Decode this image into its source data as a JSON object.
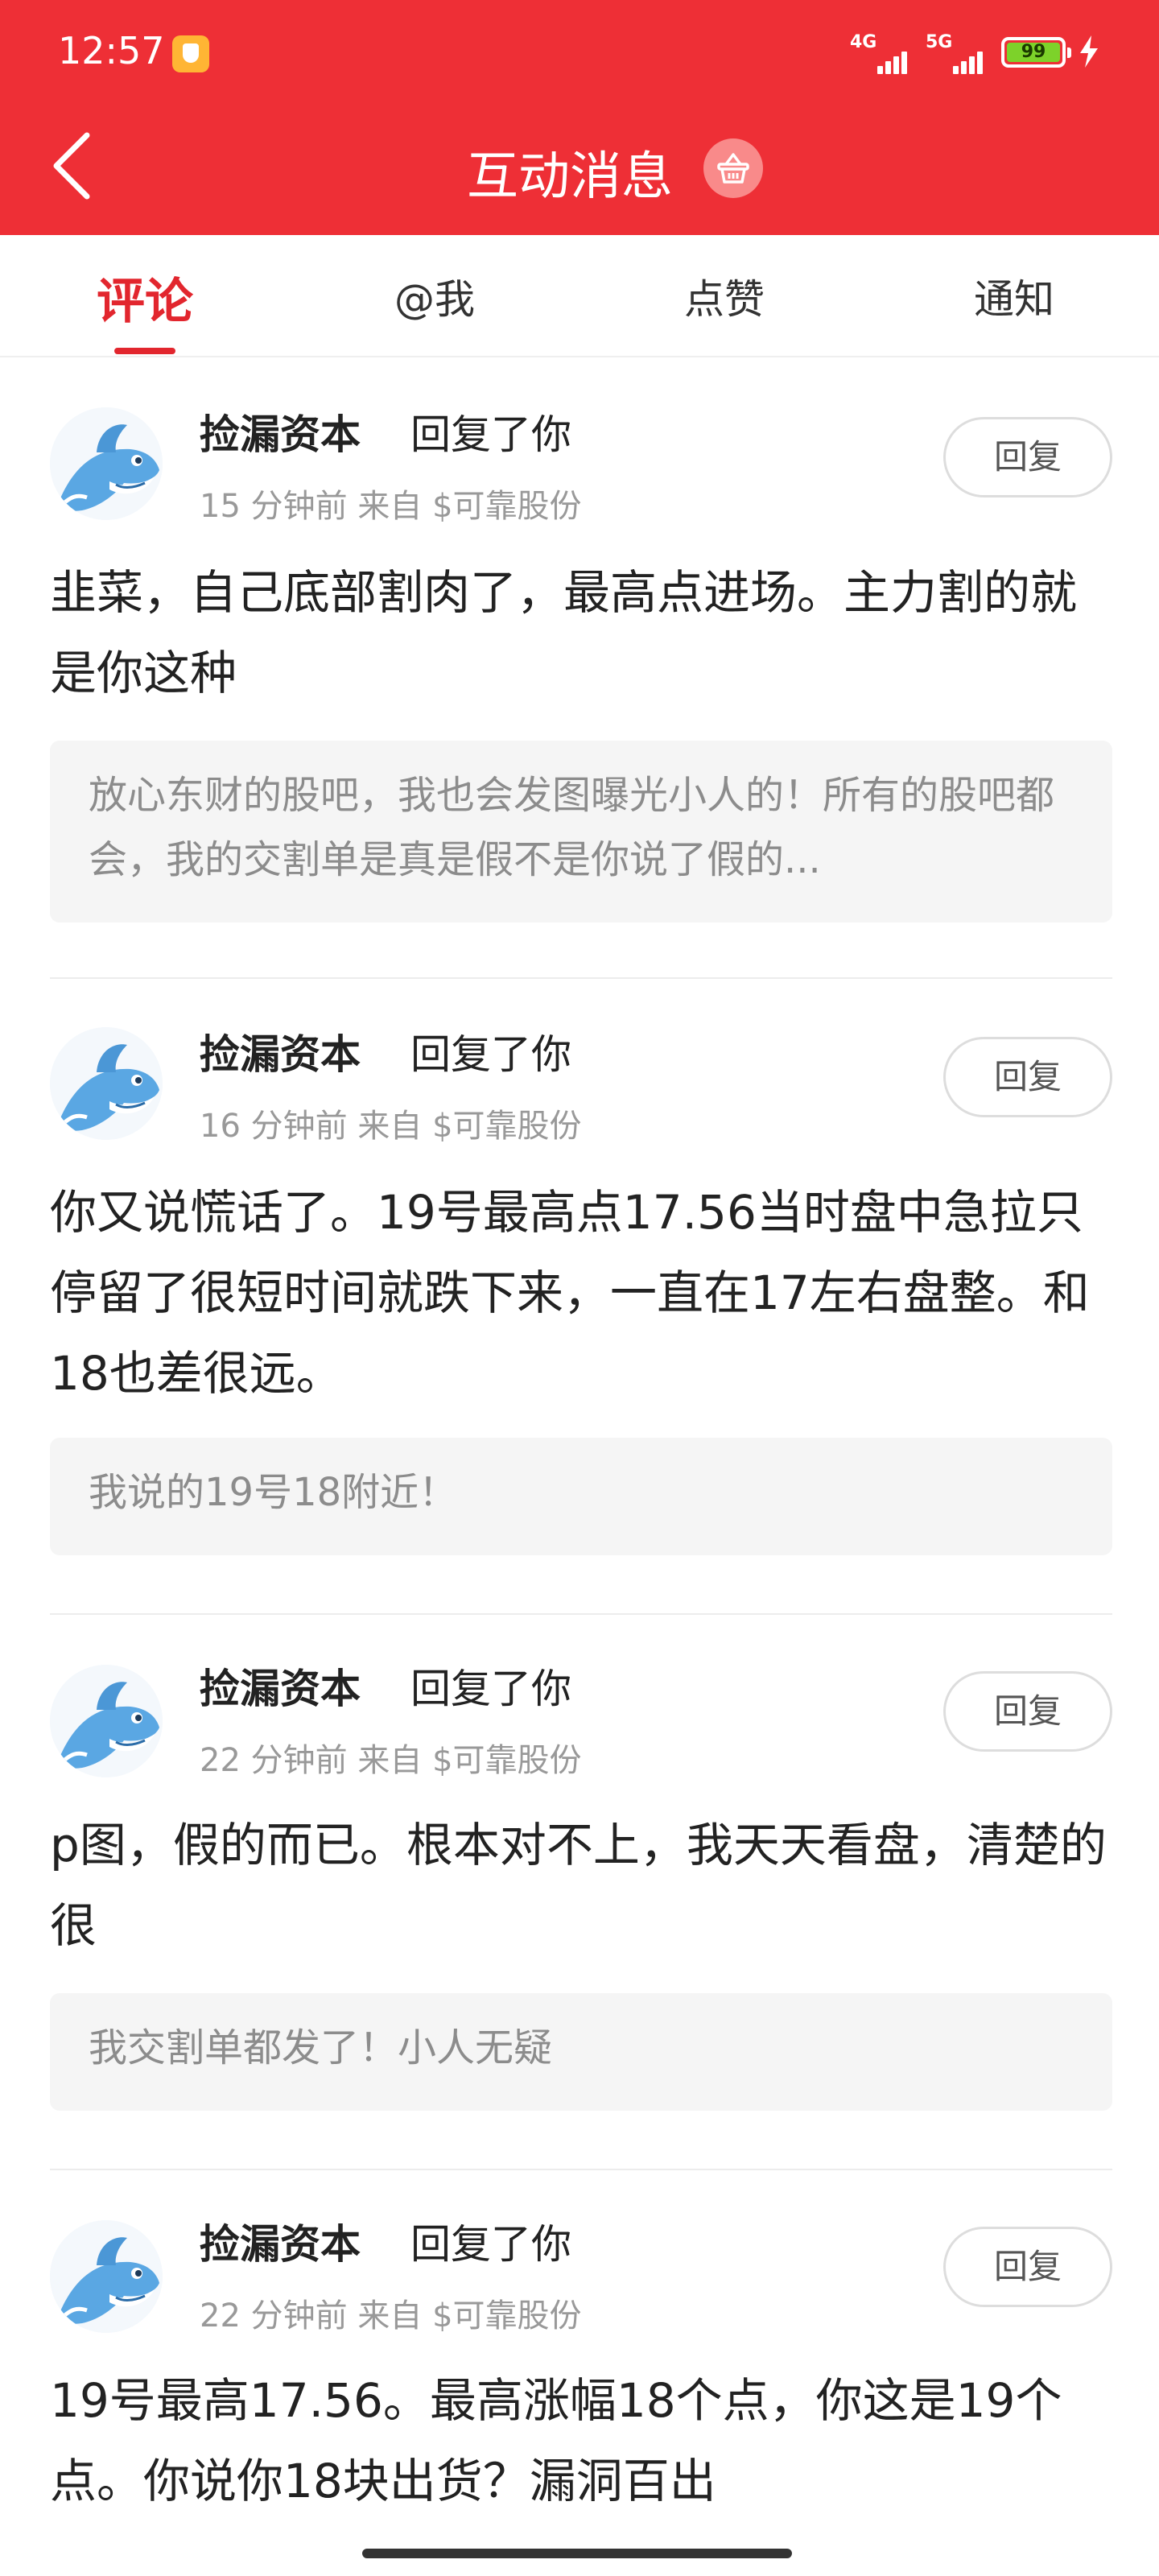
{
  "status_bar": {
    "time": "12:57",
    "net1": "4G",
    "net2": "5G",
    "battery": "99"
  },
  "header": {
    "title": "互动消息",
    "back_icon": "chevron-left-icon",
    "basket_icon": "basket-icon"
  },
  "tabs": [
    {
      "label": "评论",
      "active": true
    },
    {
      "label": "@我",
      "active": false
    },
    {
      "label": "点赞",
      "active": false
    },
    {
      "label": "通知",
      "active": false
    }
  ],
  "messages": [
    {
      "user": "捡漏资本",
      "action": "回复了你",
      "time": "15 分钟前",
      "from": "来自",
      "source": "$可靠股份",
      "reply_label": "回复",
      "comment": "韭菜，自己底部割肉了，最高点进场。主力割的就是你这种",
      "quote": "放心东财的股吧，我也会发图曝光小人的！所有的股吧都会，我的交割单是真是假不是你说了假的..."
    },
    {
      "user": "捡漏资本",
      "action": "回复了你",
      "time": "16 分钟前",
      "from": "来自",
      "source": "$可靠股份",
      "reply_label": "回复",
      "comment": "你又说慌话了。19号最高点17.56当时盘中急拉只停留了很短时间就跌下来，一直在17左右盘整。和18也差很远。",
      "quote": "我说的19号18附近！"
    },
    {
      "user": "捡漏资本",
      "action": "回复了你",
      "time": "22 分钟前",
      "from": "来自",
      "source": "$可靠股份",
      "reply_label": "回复",
      "comment": "p图，假的而已。根本对不上，我天天看盘，清楚的很",
      "quote": "我交割单都发了！小人无疑"
    },
    {
      "user": "捡漏资本",
      "action": "回复了你",
      "time": "22 分钟前",
      "from": "来自",
      "source": "$可靠股份",
      "reply_label": "回复",
      "comment": "19号最高17.56。最高涨幅18个点，你这是19个点。你说你18块出货？漏洞百出",
      "quote": ""
    }
  ],
  "colors": {
    "brand_red": "#ee2f36",
    "tab_active": "#e2262e",
    "quote_bg": "#f5f5f5",
    "meta_gray": "#999999"
  }
}
